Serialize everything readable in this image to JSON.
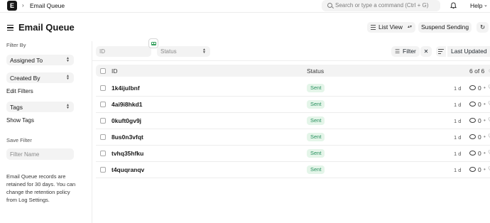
{
  "navbar": {
    "logo_letter": "E",
    "breadcrumb": "Email Queue",
    "search_placeholder": "Search or type a command (Ctrl + G)",
    "help_label": "Help"
  },
  "header": {
    "title": "Email Queue",
    "list_view_label": "List View",
    "suspend_label": "Suspend Sending",
    "refresh_icon": "↻"
  },
  "sidebar": {
    "filter_by_label": "Filter By",
    "assigned_to_label": "Assigned To",
    "created_by_label": "Created By",
    "edit_filters_label": "Edit Filters",
    "tags_label": "Tags",
    "show_tags_label": "Show Tags",
    "save_filter_label": "Save Filter",
    "filter_name_placeholder": "Filter Name",
    "note": "Email Queue records are retained for 30 days. You can change the retention policy from Log Settings."
  },
  "filters": {
    "id_placeholder": "ID",
    "status_placeholder": "Status",
    "filter_label": "Filter",
    "clear_label": "✕",
    "sort_label": "Last Updated"
  },
  "list": {
    "col_id": "ID",
    "col_status": "Status",
    "count": "6 of 6",
    "rows": [
      {
        "id": "1k4ijulbnf",
        "status": "Sent",
        "age": "1 d",
        "comments": "0"
      },
      {
        "id": "4ai9i8hkd1",
        "status": "Sent",
        "age": "1 d",
        "comments": "0"
      },
      {
        "id": "0kuft0gv9j",
        "status": "Sent",
        "age": "1 d",
        "comments": "0"
      },
      {
        "id": "8us0n3vfqt",
        "status": "Sent",
        "age": "1 d",
        "comments": "0"
      },
      {
        "id": "tvhq35hfku",
        "status": "Sent",
        "age": "1 d",
        "comments": "0"
      },
      {
        "id": "t4quqranqv",
        "status": "Sent",
        "age": "1 d",
        "comments": "0"
      }
    ]
  },
  "colors": {
    "accent_dark": "#171717",
    "badge_bg": "#e4f5e9",
    "badge_text": "#278f5e",
    "control_bg": "#f3f3f3"
  }
}
